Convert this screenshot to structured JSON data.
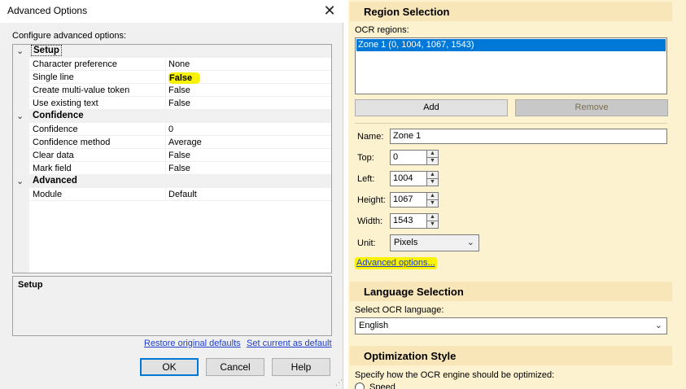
{
  "dialog": {
    "title": "Advanced Options",
    "close_glyph": "✕",
    "configure_label": "Configure advanced options:",
    "categories": [
      {
        "name": "Setup",
        "properties": [
          {
            "name": "Character preference",
            "value": "None"
          },
          {
            "name": "Single line",
            "value": "False"
          },
          {
            "name": "Create multi-value token",
            "value": "False"
          },
          {
            "name": "Use existing text",
            "value": "False"
          }
        ]
      },
      {
        "name": "Confidence",
        "properties": [
          {
            "name": "Confidence",
            "value": "0"
          },
          {
            "name": "Confidence method",
            "value": "Average"
          },
          {
            "name": "Clear data",
            "value": "False"
          },
          {
            "name": "Mark field",
            "value": "False"
          }
        ]
      },
      {
        "name": "Advanced",
        "properties": [
          {
            "name": "Module",
            "value": "Default"
          }
        ]
      }
    ],
    "collapse_glyph": "⌄",
    "description_title": "Setup",
    "restore_link": "Restore original defaults",
    "set_default_link": "Set current as default",
    "ok_label": "OK",
    "cancel_label": "Cancel",
    "help_label": "Help"
  },
  "panel": {
    "region_heading": "Region Selection",
    "ocr_regions_label": "OCR regions:",
    "regions": [
      "Zone 1 (0, 1004, 1067, 1543)"
    ],
    "add_label": "Add",
    "remove_label": "Remove",
    "name_label": "Name:",
    "name_value": "Zone 1",
    "top_label": "Top:",
    "top_value": "0",
    "left_label": "Left:",
    "left_value": "1004",
    "height_label": "Height:",
    "height_value": "1067",
    "width_label": "Width:",
    "width_value": "1543",
    "unit_label": "Unit:",
    "unit_value": "Pixels",
    "advanced_link": "Advanced options...",
    "language_heading": "Language Selection",
    "language_label": "Select OCR language:",
    "language_value": "English",
    "optimization_heading": "Optimization Style",
    "optimization_label": "Specify how the OCR engine should be optimized:",
    "speed_label": "Speed"
  },
  "colors": {
    "highlight": "#f9f200",
    "selection": "#0078d7",
    "panel_bg": "#fcf2d0",
    "section_header": "#f8e6b9",
    "link": "#1e3dcc"
  }
}
